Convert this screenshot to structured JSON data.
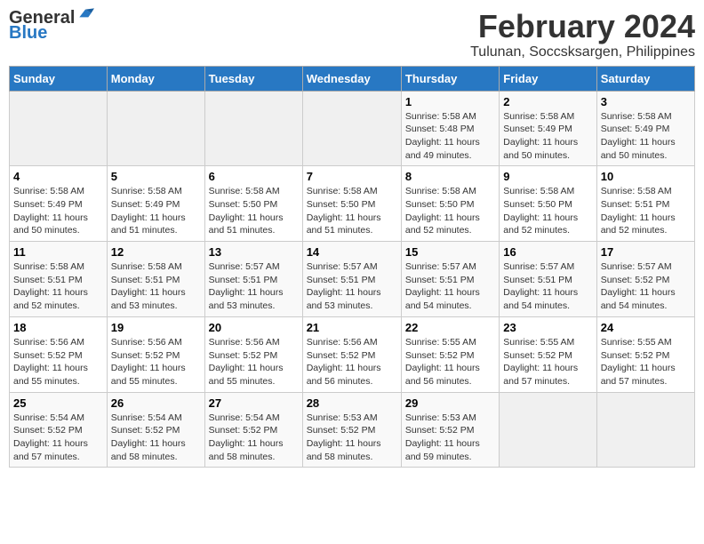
{
  "header": {
    "logo_line1": "General",
    "logo_line2": "Blue",
    "title": "February 2024",
    "subtitle": "Tulunan, Soccsksargen, Philippines"
  },
  "days_of_week": [
    "Sunday",
    "Monday",
    "Tuesday",
    "Wednesday",
    "Thursday",
    "Friday",
    "Saturday"
  ],
  "weeks": [
    [
      {
        "day": "",
        "info": ""
      },
      {
        "day": "",
        "info": ""
      },
      {
        "day": "",
        "info": ""
      },
      {
        "day": "",
        "info": ""
      },
      {
        "day": "1",
        "info": "Sunrise: 5:58 AM\nSunset: 5:48 PM\nDaylight: 11 hours and 49 minutes."
      },
      {
        "day": "2",
        "info": "Sunrise: 5:58 AM\nSunset: 5:49 PM\nDaylight: 11 hours and 50 minutes."
      },
      {
        "day": "3",
        "info": "Sunrise: 5:58 AM\nSunset: 5:49 PM\nDaylight: 11 hours and 50 minutes."
      }
    ],
    [
      {
        "day": "4",
        "info": "Sunrise: 5:58 AM\nSunset: 5:49 PM\nDaylight: 11 hours and 50 minutes."
      },
      {
        "day": "5",
        "info": "Sunrise: 5:58 AM\nSunset: 5:49 PM\nDaylight: 11 hours and 51 minutes."
      },
      {
        "day": "6",
        "info": "Sunrise: 5:58 AM\nSunset: 5:50 PM\nDaylight: 11 hours and 51 minutes."
      },
      {
        "day": "7",
        "info": "Sunrise: 5:58 AM\nSunset: 5:50 PM\nDaylight: 11 hours and 51 minutes."
      },
      {
        "day": "8",
        "info": "Sunrise: 5:58 AM\nSunset: 5:50 PM\nDaylight: 11 hours and 52 minutes."
      },
      {
        "day": "9",
        "info": "Sunrise: 5:58 AM\nSunset: 5:50 PM\nDaylight: 11 hours and 52 minutes."
      },
      {
        "day": "10",
        "info": "Sunrise: 5:58 AM\nSunset: 5:51 PM\nDaylight: 11 hours and 52 minutes."
      }
    ],
    [
      {
        "day": "11",
        "info": "Sunrise: 5:58 AM\nSunset: 5:51 PM\nDaylight: 11 hours and 52 minutes."
      },
      {
        "day": "12",
        "info": "Sunrise: 5:58 AM\nSunset: 5:51 PM\nDaylight: 11 hours and 53 minutes."
      },
      {
        "day": "13",
        "info": "Sunrise: 5:57 AM\nSunset: 5:51 PM\nDaylight: 11 hours and 53 minutes."
      },
      {
        "day": "14",
        "info": "Sunrise: 5:57 AM\nSunset: 5:51 PM\nDaylight: 11 hours and 53 minutes."
      },
      {
        "day": "15",
        "info": "Sunrise: 5:57 AM\nSunset: 5:51 PM\nDaylight: 11 hours and 54 minutes."
      },
      {
        "day": "16",
        "info": "Sunrise: 5:57 AM\nSunset: 5:51 PM\nDaylight: 11 hours and 54 minutes."
      },
      {
        "day": "17",
        "info": "Sunrise: 5:57 AM\nSunset: 5:52 PM\nDaylight: 11 hours and 54 minutes."
      }
    ],
    [
      {
        "day": "18",
        "info": "Sunrise: 5:56 AM\nSunset: 5:52 PM\nDaylight: 11 hours and 55 minutes."
      },
      {
        "day": "19",
        "info": "Sunrise: 5:56 AM\nSunset: 5:52 PM\nDaylight: 11 hours and 55 minutes."
      },
      {
        "day": "20",
        "info": "Sunrise: 5:56 AM\nSunset: 5:52 PM\nDaylight: 11 hours and 55 minutes."
      },
      {
        "day": "21",
        "info": "Sunrise: 5:56 AM\nSunset: 5:52 PM\nDaylight: 11 hours and 56 minutes."
      },
      {
        "day": "22",
        "info": "Sunrise: 5:55 AM\nSunset: 5:52 PM\nDaylight: 11 hours and 56 minutes."
      },
      {
        "day": "23",
        "info": "Sunrise: 5:55 AM\nSunset: 5:52 PM\nDaylight: 11 hours and 57 minutes."
      },
      {
        "day": "24",
        "info": "Sunrise: 5:55 AM\nSunset: 5:52 PM\nDaylight: 11 hours and 57 minutes."
      }
    ],
    [
      {
        "day": "25",
        "info": "Sunrise: 5:54 AM\nSunset: 5:52 PM\nDaylight: 11 hours and 57 minutes."
      },
      {
        "day": "26",
        "info": "Sunrise: 5:54 AM\nSunset: 5:52 PM\nDaylight: 11 hours and 58 minutes."
      },
      {
        "day": "27",
        "info": "Sunrise: 5:54 AM\nSunset: 5:52 PM\nDaylight: 11 hours and 58 minutes."
      },
      {
        "day": "28",
        "info": "Sunrise: 5:53 AM\nSunset: 5:52 PM\nDaylight: 11 hours and 58 minutes."
      },
      {
        "day": "29",
        "info": "Sunrise: 5:53 AM\nSunset: 5:52 PM\nDaylight: 11 hours and 59 minutes."
      },
      {
        "day": "",
        "info": ""
      },
      {
        "day": "",
        "info": ""
      }
    ]
  ]
}
